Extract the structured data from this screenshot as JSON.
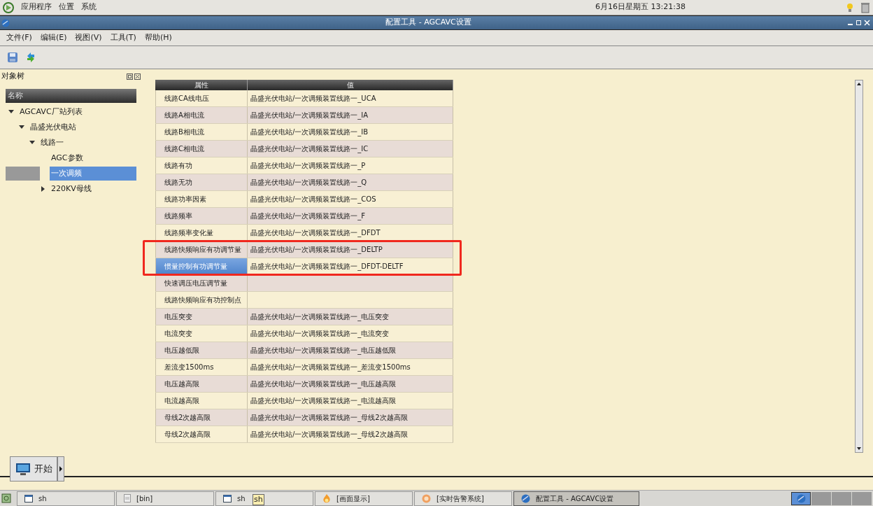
{
  "top_panel": {
    "menus": [
      "应用程序",
      "位置",
      "系统"
    ],
    "clock": "6月16日星期五 13:21:38"
  },
  "window": {
    "title": "配置工具 - AGCAVC设置"
  },
  "menu_bar": [
    "文件(F)",
    "编辑(E)",
    "视图(V)",
    "工具(T)",
    "帮助(H)"
  ],
  "tree_panel": {
    "title": "对象树",
    "column": "名称",
    "items": [
      {
        "label": "AGCAVC厂站列表",
        "expanded": true,
        "selected": false,
        "children": [
          {
            "label": "晶盛光伏电站",
            "expanded": true,
            "selected": false,
            "children": [
              {
                "label": "线路一",
                "expanded": true,
                "selected": false,
                "children": [
                  {
                    "label": "AGC参数",
                    "selected": false
                  },
                  {
                    "label": "一次调频",
                    "selected": true
                  },
                  {
                    "label": "220KV母线",
                    "expanded": false,
                    "selected": false
                  }
                ]
              }
            ]
          }
        ]
      }
    ]
  },
  "table": {
    "columns": [
      "属性",
      "值"
    ],
    "rows": [
      {
        "property": "线路CA线电压",
        "value": "晶盛光伏电站/一次调频装置线路一_UCA",
        "selected": false
      },
      {
        "property": "线路A相电流",
        "value": "晶盛光伏电站/一次调频装置线路一_IA",
        "selected": false
      },
      {
        "property": "线路B相电流",
        "value": "晶盛光伏电站/一次调频装置线路一_IB",
        "selected": false
      },
      {
        "property": "线路C相电流",
        "value": "晶盛光伏电站/一次调频装置线路一_IC",
        "selected": false
      },
      {
        "property": "线路有功",
        "value": "晶盛光伏电站/一次调频装置线路一_P",
        "selected": false
      },
      {
        "property": "线路无功",
        "value": "晶盛光伏电站/一次调频装置线路一_Q",
        "selected": false
      },
      {
        "property": "线路功率因素",
        "value": "晶盛光伏电站/一次调频装置线路一_COS",
        "selected": false
      },
      {
        "property": "线路频率",
        "value": "晶盛光伏电站/一次调频装置线路一_F",
        "selected": false
      },
      {
        "property": "线路频率变化量",
        "value": "晶盛光伏电站/一次调频装置线路一_DFDT",
        "selected": false
      },
      {
        "property": "线路快频响应有功调节量",
        "value": "晶盛光伏电站/一次调频装置线路一_DELTP",
        "selected": false
      },
      {
        "property": "惯量控制有功调节量",
        "value": "晶盛光伏电站/一次调频装置线路一_DFDT-DELTF",
        "selected": true
      },
      {
        "property": "快速调压电压调节量",
        "selected": false
      },
      {
        "property": "线路快频响应有功控制点",
        "selected": false
      },
      {
        "property": "电压突变",
        "value": "晶盛光伏电站/一次调频装置线路一_电压突变",
        "selected": false
      },
      {
        "property": "电流突变",
        "value": "晶盛光伏电站/一次调频装置线路一_电流突变",
        "selected": false
      },
      {
        "property": "电压越低限",
        "value": "晶盛光伏电站/一次调频装置线路一_电压越低限",
        "selected": false
      },
      {
        "property": "差流变1500ms",
        "value": "晶盛光伏电站/一次调频装置线路一_差流变1500ms",
        "selected": false
      },
      {
        "property": "电压越高限",
        "value": "晶盛光伏电站/一次调频装置线路一_电压越高限",
        "selected": false
      },
      {
        "property": "电流越高限",
        "value": "晶盛光伏电站/一次调频装置线路一_电流越高限",
        "selected": false
      },
      {
        "property": "母线2次越高限",
        "value": "晶盛光伏电站/一次调频装置线路一_母线2次越高限",
        "selected": false
      },
      {
        "property": "母线2次越高限",
        "value": "晶盛光伏电站/一次调频装置线路一_母线2次越高限",
        "selected": false
      }
    ]
  },
  "start_button": {
    "label": "开始"
  },
  "taskbar": {
    "items": [
      {
        "label": "sh",
        "selected": false
      },
      {
        "label": "[bin]",
        "selected": false
      },
      {
        "label": "sh",
        "selected": false,
        "tooltip": "sh"
      },
      {
        "label": "[画面显示]",
        "selected": false
      },
      {
        "label": "[实时告警系统]",
        "selected": false
      },
      {
        "label": "配置工具 - AGCAVC设置",
        "selected": true
      }
    ]
  }
}
